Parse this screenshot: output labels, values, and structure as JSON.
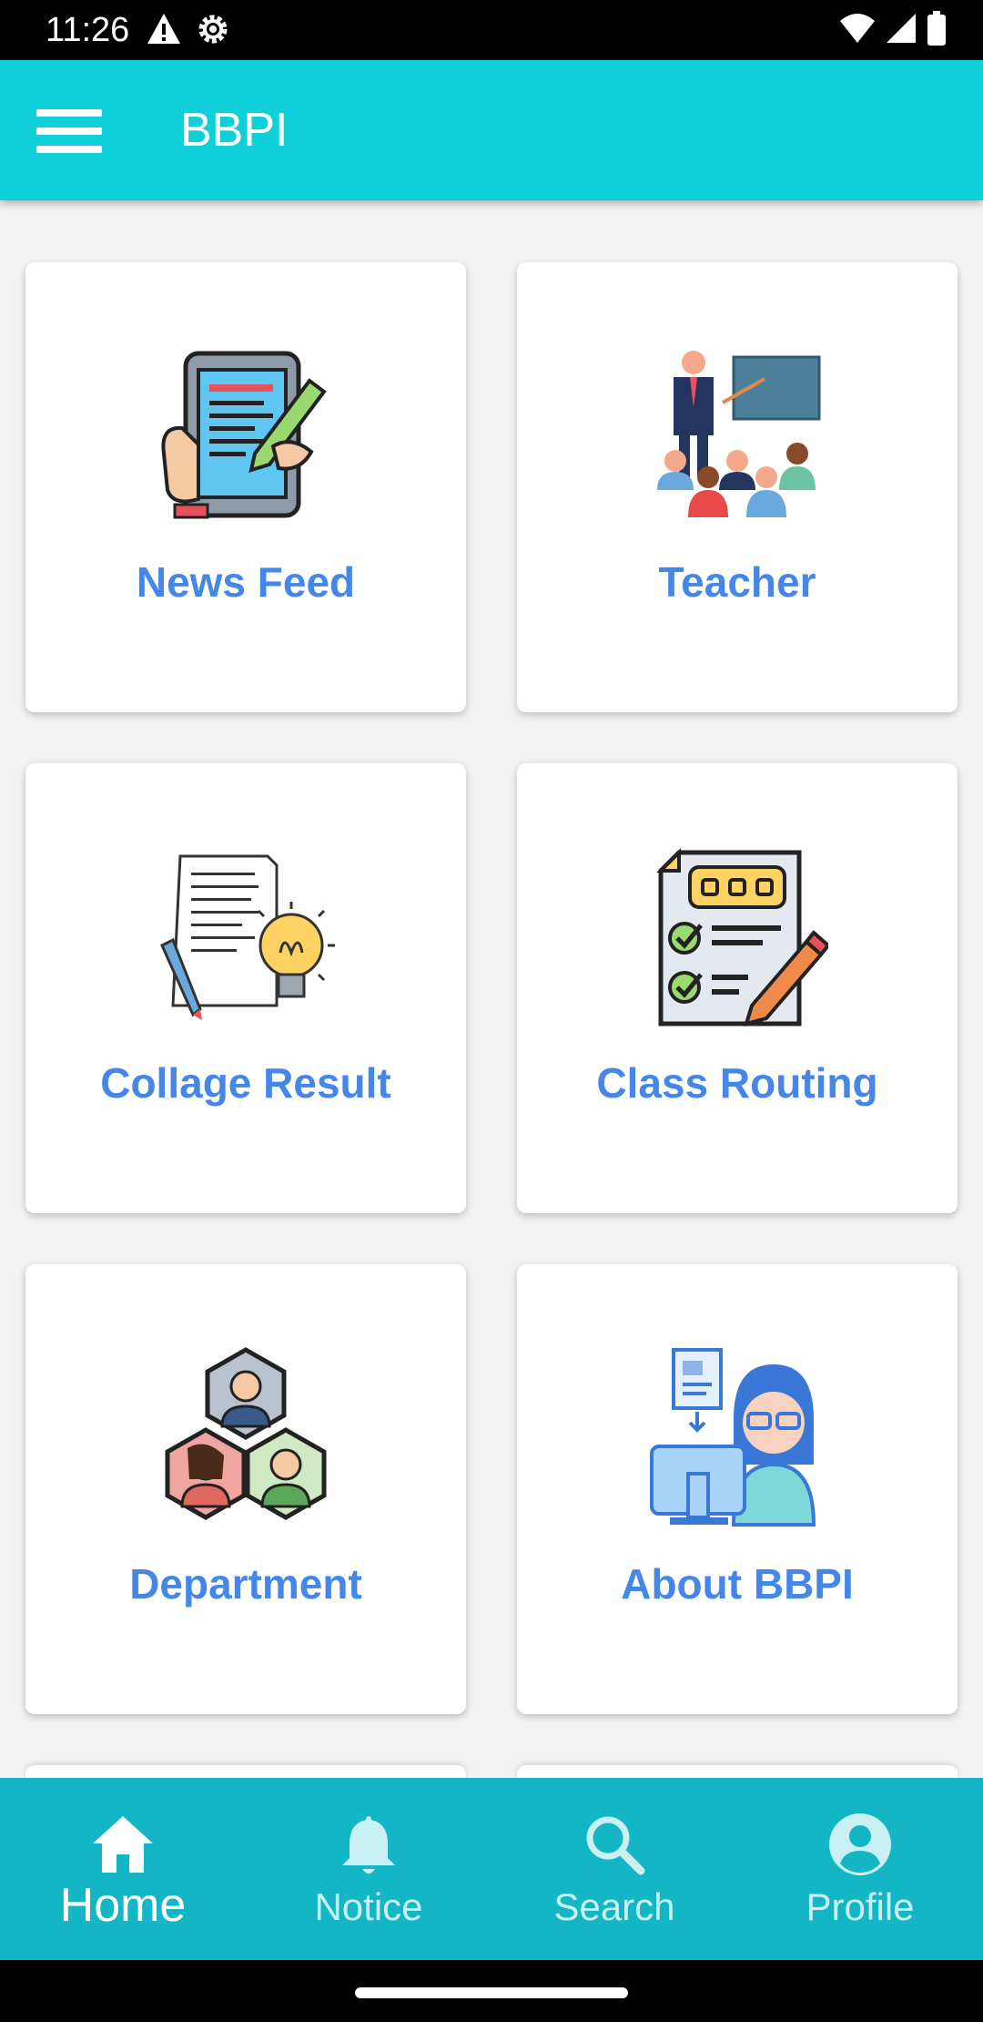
{
  "status_bar": {
    "time": "11:26",
    "left_icons": [
      "warning-icon",
      "settings-icon"
    ],
    "right_icons": [
      "wifi-icon",
      "signal-icon",
      "battery-icon"
    ]
  },
  "app_bar": {
    "title": "BBPI",
    "menu_icon": "hamburger-menu-icon",
    "background": "#0fcfd9"
  },
  "cards": [
    {
      "label": "News Feed",
      "icon": "tablet-writing-icon"
    },
    {
      "label": "Teacher",
      "icon": "teacher-classroom-icon"
    },
    {
      "label": "Collage Result",
      "icon": "paper-lightbulb-icon"
    },
    {
      "label": "Class Routing",
      "icon": "checklist-pencil-icon"
    },
    {
      "label": "Department",
      "icon": "people-hexagon-icon"
    },
    {
      "label": "About BBPI",
      "icon": "woman-computer-icon"
    }
  ],
  "label_color": "#4487e8",
  "bottom_nav": {
    "background": "#12b6c4",
    "items": [
      {
        "label": "Home",
        "icon": "home-icon",
        "active": true
      },
      {
        "label": "Notice",
        "icon": "bell-icon",
        "active": false
      },
      {
        "label": "Search",
        "icon": "search-icon",
        "active": false
      },
      {
        "label": "Profile",
        "icon": "profile-icon",
        "active": false
      }
    ]
  }
}
